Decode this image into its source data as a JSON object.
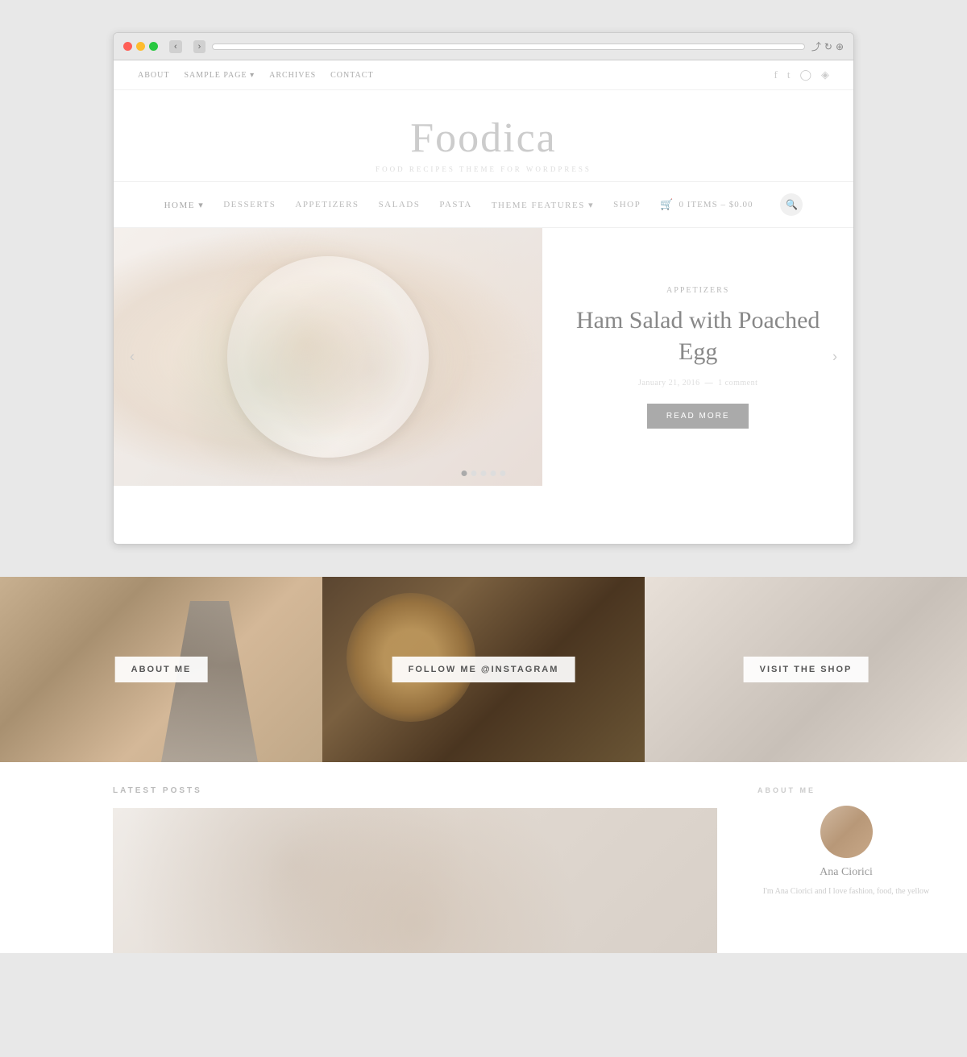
{
  "browser": {
    "url": "",
    "dots": [
      "red",
      "yellow",
      "green"
    ]
  },
  "top_nav": {
    "links": [
      {
        "label": "ABOUT",
        "href": "#"
      },
      {
        "label": "SAMPLE PAGE",
        "href": "#"
      },
      {
        "label": "ARCHIVES",
        "href": "#"
      },
      {
        "label": "CONTACT",
        "href": "#"
      }
    ],
    "social": [
      "f",
      "t",
      "ig",
      "p"
    ]
  },
  "site": {
    "title": "Foodica",
    "subtitle": "FOOD RECIPES THEME FOR WORDPRESS"
  },
  "main_nav": {
    "items": [
      {
        "label": "HOME",
        "active": true
      },
      {
        "label": "DESSERTS"
      },
      {
        "label": "APPETIZERS"
      },
      {
        "label": "SALADS"
      },
      {
        "label": "PASTA"
      },
      {
        "label": "THEME FEATURES"
      },
      {
        "label": "SHOP"
      }
    ],
    "cart_label": "0 ITEMS – $0.00"
  },
  "hero": {
    "category": "Appetizers",
    "title": "Ham Salad with Poached Egg",
    "date": "January 21, 2016",
    "comments": "1 comment",
    "read_more": "READ MORE",
    "dots": 5,
    "active_dot": 0
  },
  "banners": [
    {
      "label": "ABOUT ME"
    },
    {
      "label": "FOLLOW ME @INSTAGRAM"
    },
    {
      "label": "VISIT THE SHOP"
    }
  ],
  "latest_posts": {
    "section_title": "LATEST POSTS"
  },
  "sidebar": {
    "about_title": "ABOUT ME",
    "author_name": "Ana Ciorici",
    "author_desc": "I'm Ana Ciorici and I love fashion, food, the yellow"
  }
}
